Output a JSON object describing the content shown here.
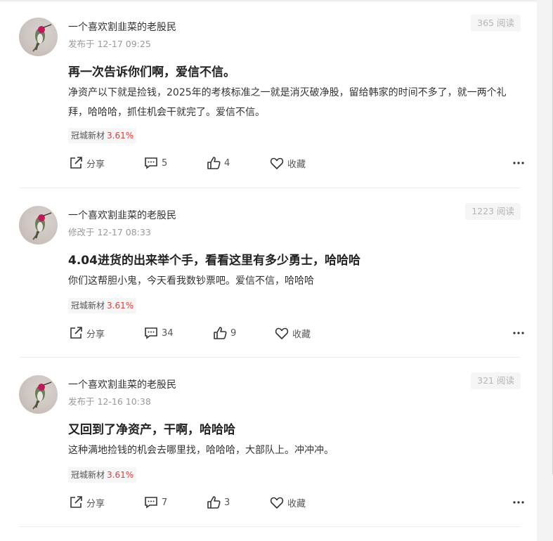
{
  "posts": [
    {
      "author": "一个喜欢割韭菜的老股民",
      "time": "发布于 12-17 09:25",
      "reads": "365 阅读",
      "title": "再一次告诉你们啊，爱信不信。",
      "content": "净资产以下就是捡钱，2025年的考核标准之一就是消灭破净股，留给韩家的时间不多了，就一两个礼拜，哈哈哈，抓住机会干就完了。爱信不信。",
      "tag": {
        "name": "冠城新材",
        "change": "3.61%"
      },
      "share_label": "分享",
      "comments": "5",
      "likes": "4",
      "collect_label": "收藏"
    },
    {
      "author": "一个喜欢割韭菜的老股民",
      "time": "修改于 12-17 08:33",
      "reads": "1223 阅读",
      "title": "4.04进货的出来举个手，看看这里有多少勇士，哈哈哈",
      "content": "你们这帮胆小鬼，今天看我数钞票吧。爱信不信，哈哈哈",
      "tag": {
        "name": "冠城新材",
        "change": "3.61%"
      },
      "share_label": "分享",
      "comments": "34",
      "likes": "9",
      "collect_label": "收藏"
    },
    {
      "author": "一个喜欢割韭菜的老股民",
      "time": "发布于 12-16 10:38",
      "reads": "321 阅读",
      "title": "又回到了净资产，干啊，哈哈哈",
      "content": "这种满地捡钱的机会去哪里找，哈哈哈，大部队上。冲冲冲。",
      "tag": {
        "name": "冠城新材",
        "change": "3.61%"
      },
      "share_label": "分享",
      "comments": "7",
      "likes": "3",
      "collect_label": "收藏"
    }
  ],
  "colors": {
    "up": "#e53935",
    "muted": "#999999"
  },
  "icons": [
    "avatar-hummingbird",
    "share-icon",
    "comment-icon",
    "like-icon",
    "collect-heart-icon",
    "more-icon"
  ]
}
